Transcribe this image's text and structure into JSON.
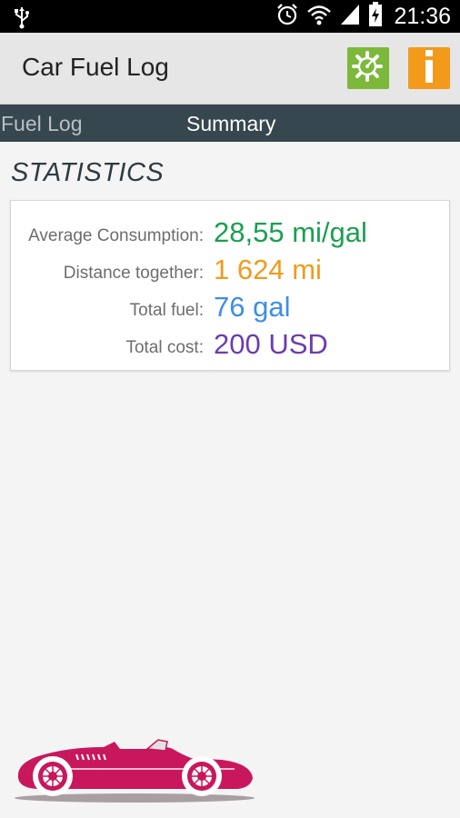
{
  "status_bar": {
    "time": "21:36",
    "icons": [
      "usb-icon",
      "alarm-icon",
      "wifi-icon",
      "signal-icon",
      "battery-charging-icon"
    ]
  },
  "action_bar": {
    "title": "Car Fuel Log",
    "settings_icon": "gear-settings-icon",
    "info_icon": "info-icon",
    "colors": {
      "settings": "#7cb83a",
      "info": "#f39a1b"
    }
  },
  "tabs": [
    {
      "label": "Fuel Log",
      "selected": false
    },
    {
      "label": "Summary",
      "selected": true
    }
  ],
  "section": {
    "title": "STATISTICS"
  },
  "stats": [
    {
      "label": "Average Consumption:",
      "value": "28,55 mi/gal",
      "color": "#1aa04f"
    },
    {
      "label": "Distance together:",
      "value": "1 624 mi",
      "color": "#f39a1b"
    },
    {
      "label": "Total fuel:",
      "value": "76 gal",
      "color": "#3d8ee6"
    },
    {
      "label": "Total cost:",
      "value": "200 USD",
      "color": "#6a3db0"
    }
  ],
  "footer": {
    "logo_icon": "race-car-icon",
    "logo_color": "#c8175c"
  }
}
